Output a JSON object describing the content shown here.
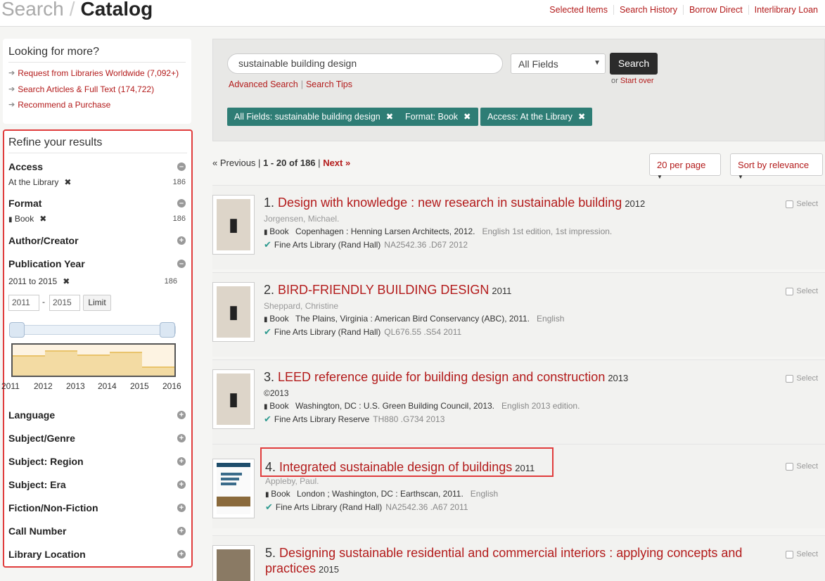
{
  "header": {
    "breadcrumb_search": "Search",
    "breadcrumb_sep": "/",
    "breadcrumb_catalog": "Catalog",
    "nav": [
      "Selected Items",
      "Search History",
      "Borrow Direct",
      "Interlibrary Loan"
    ]
  },
  "looking": {
    "title": "Looking for more?",
    "links": [
      "Request from Libraries Worldwide (7,092+)",
      "Search Articles & Full Text (174,722)",
      "Recommend a Purchase"
    ]
  },
  "refine": {
    "title": "Refine your results",
    "access": {
      "label": "Access",
      "value": "At the Library",
      "count": "186"
    },
    "format": {
      "label": "Format",
      "value": "Book",
      "count": "186"
    },
    "author": "Author/Creator",
    "pubyear": {
      "label": "Publication Year",
      "value": "2011 to 2015",
      "count": "186",
      "from": "2011",
      "to": "2015",
      "limit": "Limit"
    },
    "histogram": {
      "years": [
        "2011",
        "2012",
        "2013",
        "2014",
        "2015",
        "2016"
      ],
      "levels": [
        0.65,
        0.82,
        0.68,
        0.78,
        0.3
      ]
    },
    "more_facets": [
      "Language",
      "Subject/Genre",
      "Subject: Region",
      "Subject: Era",
      "Fiction/Non-Fiction",
      "Call Number",
      "Library Location"
    ]
  },
  "search": {
    "query": "sustainable building design",
    "field": "All Fields",
    "button": "Search",
    "or_text": "or",
    "start_over": "Start over",
    "advanced": "Advanced Search",
    "tips": "Search Tips",
    "chips": [
      "All Fields: sustainable building design",
      "Format: Book",
      "Access: At the Library"
    ]
  },
  "pager": {
    "previous": "« Previous",
    "range": "1 - 20",
    "of": "of",
    "total": "186",
    "next": "Next »",
    "per_page": "20 per page",
    "sort": "Sort by relevance"
  },
  "results": [
    {
      "num": "1.",
      "title": "Design with knowledge : new research in sustainable building",
      "year": "2012",
      "author": "Jorgensen, Michael.",
      "format": "Book",
      "pub": "Copenhagen : Henning Larsen Architects, 2012.",
      "extra": "English 1st edition, 1st impression.",
      "location": "Fine Arts Library (Rand Hall)",
      "call": "NA2542.36 .D67 2012",
      "select": "Select"
    },
    {
      "num": "2.",
      "title": "BIRD-FRIENDLY BUILDING DESIGN",
      "year": "2011",
      "author": "Sheppard, Christine",
      "format": "Book",
      "pub": "The Plains, Virginia : American Bird Conservancy (ABC), 2011.",
      "extra": "English",
      "location": "Fine Arts Library (Rand Hall)",
      "call": "QL676.55 .S54 2011",
      "select": "Select"
    },
    {
      "num": "3.",
      "title": "LEED reference guide for building design and construction",
      "year": "2013",
      "author": "©2013",
      "format": "Book",
      "pub": "Washington, DC : U.S. Green Building Council, 2013.",
      "extra": "English 2013 edition.",
      "location": "Fine Arts Library Reserve",
      "call": "TH880 .G734 2013",
      "select": "Select"
    },
    {
      "num": "4.",
      "title": "Integrated sustainable design of buildings",
      "year": "2011",
      "author": "Appleby, Paul.",
      "format": "Book",
      "pub": "London ; Washington, DC : Earthscan, 2011.",
      "extra": "English",
      "location": "Fine Arts Library (Rand Hall)",
      "call": "NA2542.36 .A67 2011",
      "select": "Select"
    },
    {
      "num": "5.",
      "title": "Designing sustainable residential and commercial interiors : applying concepts and",
      "title2": "practices",
      "year": "2015",
      "select": "Select"
    }
  ],
  "colors": {
    "accent": "#b31b1b",
    "chip": "#2e7d75",
    "highlight": "#e03c3c"
  }
}
